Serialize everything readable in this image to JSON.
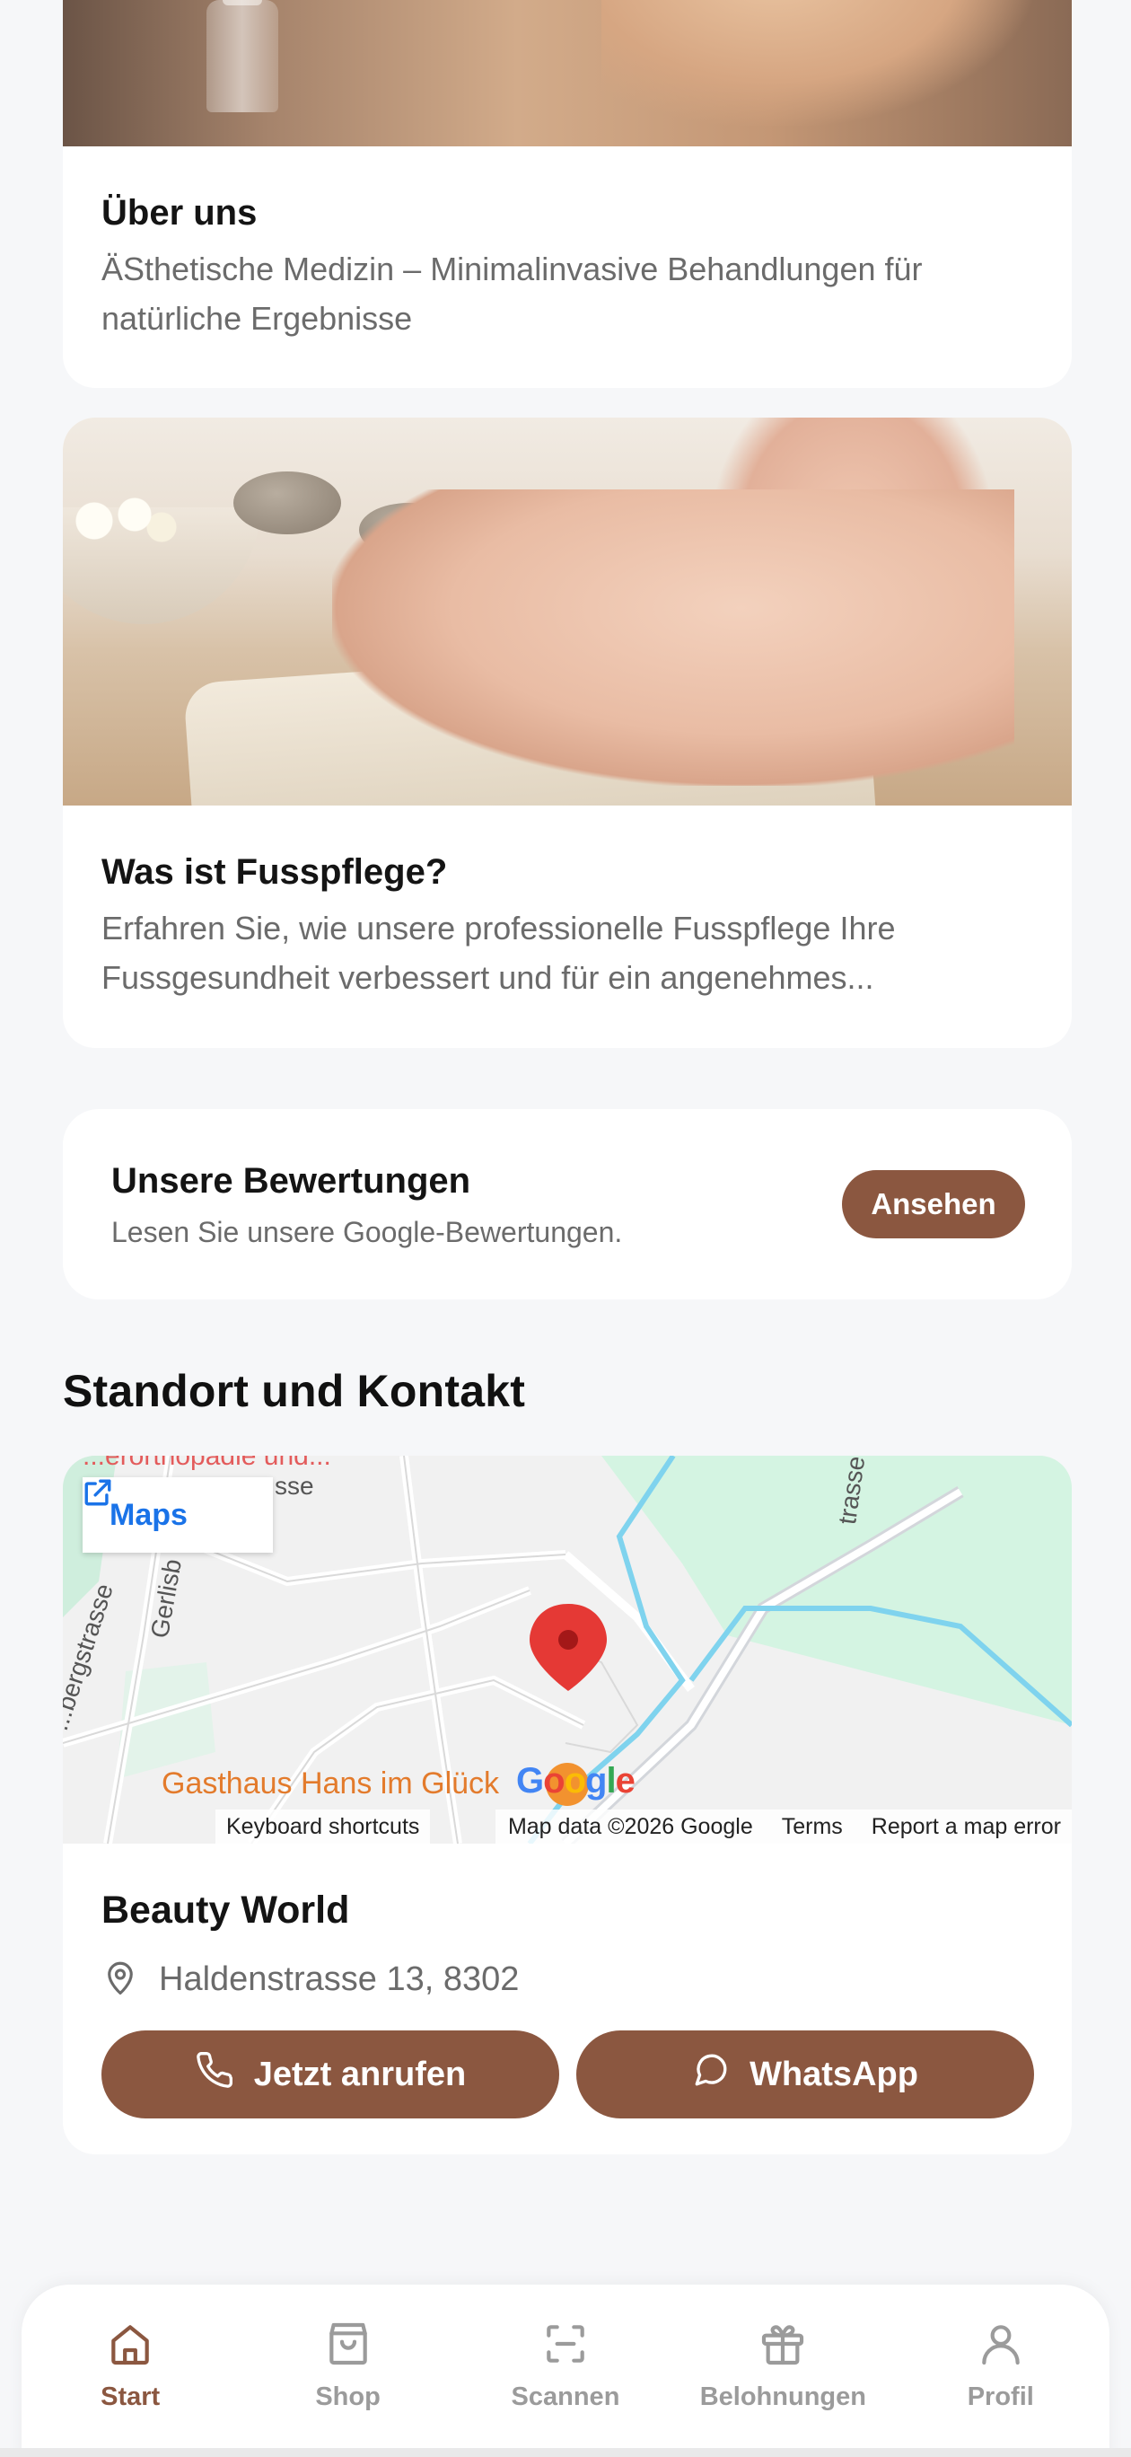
{
  "about": {
    "title": "Über uns",
    "text": "ÄSthetische Medizin – Minimalinvasive Behandlungen für natürliche Ergebnisse"
  },
  "foot_care": {
    "title": "Was ist Fusspflege?",
    "text": "Erfahren Sie, wie unsere professionelle Fusspflege Ihre Fussgesundheit verbessert und für ein angenehmes..."
  },
  "reviews": {
    "title": "Unsere Bewertungen",
    "subtitle": "Lesen Sie unsere Google-Bewertungen.",
    "button_label": "Ansehen"
  },
  "location": {
    "heading": "Standort und Kontakt",
    "map": {
      "maps_button_label": "Maps",
      "top_partial_label": "...erorthopädie und...",
      "street_label_1": "sse",
      "street_label_2": "...bergstrasse",
      "street_label_3": "Gerlisb",
      "street_label_4": "trasse",
      "place_label": "Gasthaus Hans im Glück",
      "google_logo": "Google",
      "attrib_keyboard": "Keyboard shortcuts",
      "attrib_data": "Map data ©2026 Google",
      "attrib_terms": "Terms",
      "attrib_report": "Report a map error"
    },
    "business_name": "Beauty World",
    "address": "Haldenstrasse 13, 8302",
    "call_label": "Jetzt anrufen",
    "whatsapp_label": "WhatsApp"
  },
  "nav": {
    "items": [
      {
        "label": "Start",
        "icon": "home-icon",
        "active": true
      },
      {
        "label": "Shop",
        "icon": "shopping-bag-icon",
        "active": false
      },
      {
        "label": "Scannen",
        "icon": "scan-icon",
        "active": false
      },
      {
        "label": "Belohnungen",
        "icon": "gift-icon",
        "active": false
      },
      {
        "label": "Profil",
        "icon": "user-icon",
        "active": false
      }
    ]
  },
  "colors": {
    "accent": "#8b5740",
    "background": "#f6f7f9",
    "muted_text": "#6b6b6b",
    "map_link": "#1a73e8"
  }
}
